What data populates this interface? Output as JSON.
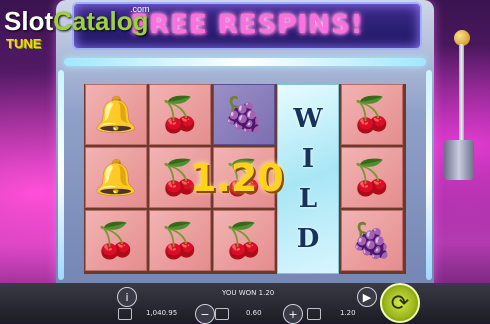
{
  "logo": {
    "brand_slot": "Slot",
    "brand_catalog": "Catalog",
    "com": ".com",
    "game": "TUNE"
  },
  "banner": {
    "title": "FREE RESPINS!"
  },
  "win": {
    "amount": "1.20"
  },
  "reels": [
    [
      "bell",
      "bell",
      "cherry"
    ],
    [
      "cherry",
      "cherry",
      "cherry"
    ],
    [
      "grape",
      "cherry",
      "cherry"
    ],
    [
      "wild"
    ],
    [
      "cherry",
      "cherry",
      "grape"
    ]
  ],
  "wild_letters": [
    "W",
    "I",
    "L",
    "D"
  ],
  "symbols": {
    "bell": "🔔",
    "cherry": "🍒",
    "grape": "🍇"
  },
  "bottom": {
    "info": "i",
    "you_won": "YOU WON 1.20",
    "balance": "1,040.95",
    "minus": "−",
    "bet": "0.60",
    "plus": "+",
    "win_value": "1.20",
    "autoplay": "▶",
    "spin": "⟳"
  }
}
